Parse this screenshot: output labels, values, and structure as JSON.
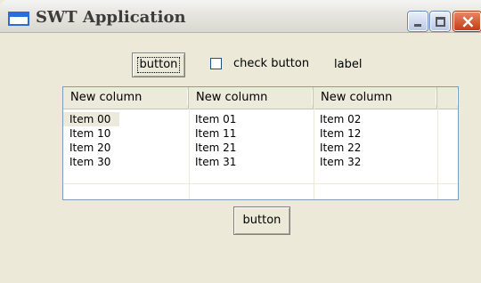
{
  "window": {
    "title": "SWT Application"
  },
  "top_row": {
    "button_label": "button",
    "check_label": "check button",
    "checked": false,
    "label": "label"
  },
  "table": {
    "columns": [
      "New column",
      "New column",
      "New column",
      ""
    ],
    "rows": [
      [
        "Item 00",
        "Item 01",
        "Item 02"
      ],
      [
        "Item 10",
        "Item 11",
        "Item 12"
      ],
      [
        "Item 20",
        "Item 21",
        "Item 22"
      ],
      [
        "Item 30",
        "Item 31",
        "Item 32"
      ]
    ],
    "selected": "Item 00"
  },
  "bottom_button_label": "button"
}
